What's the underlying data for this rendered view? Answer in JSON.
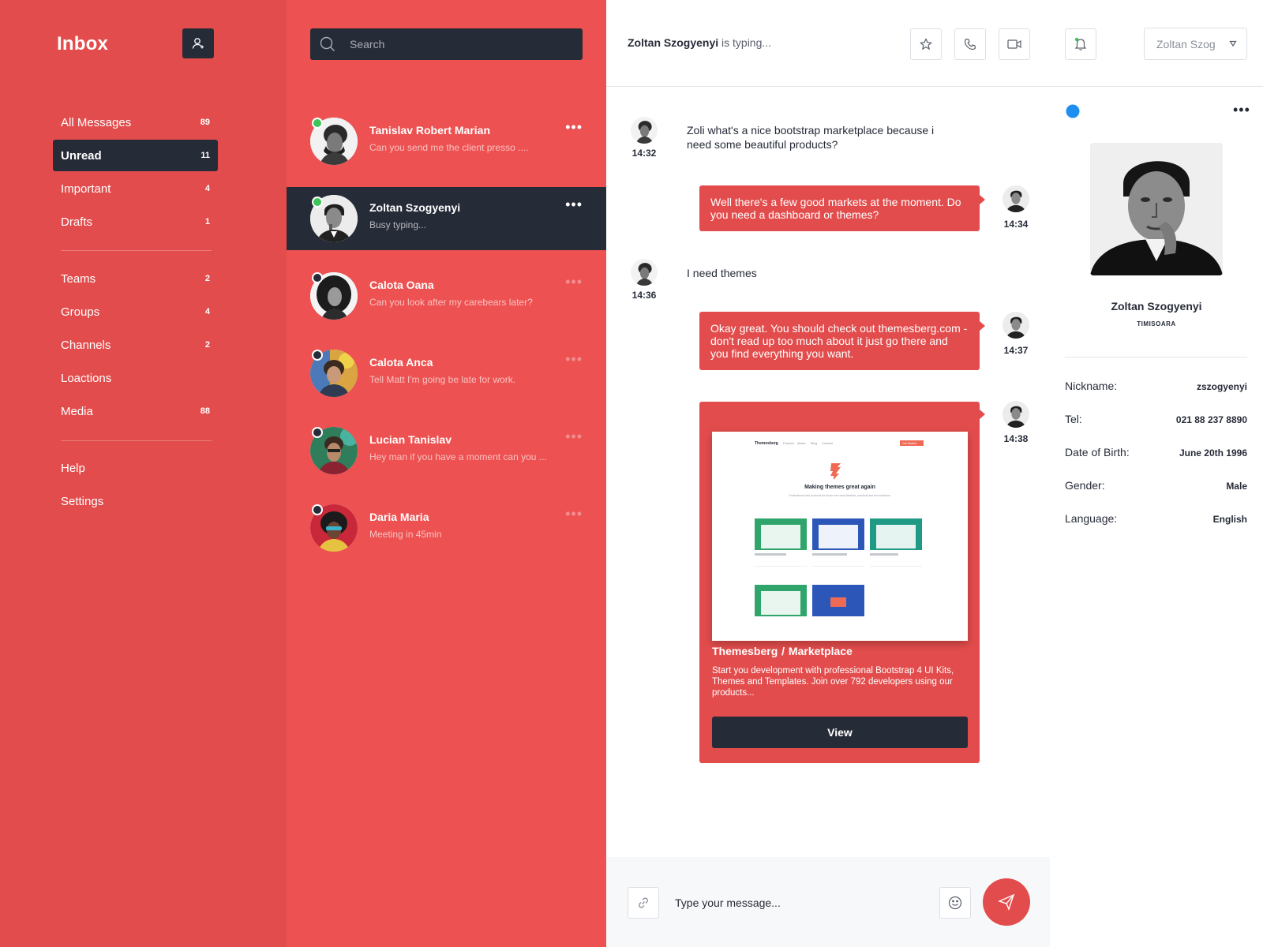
{
  "sidebar": {
    "title": "Inbox",
    "new_contact_icon": "user-plus-icon",
    "primary_items": [
      {
        "label": "All Messages",
        "count": "89"
      },
      {
        "label": "Unread",
        "count": "11"
      },
      {
        "label": "Important",
        "count": "4"
      },
      {
        "label": "Drafts",
        "count": "1"
      }
    ],
    "secondary_items": [
      {
        "label": "Teams",
        "count": "2"
      },
      {
        "label": "Groups",
        "count": "4"
      },
      {
        "label": "Channels",
        "count": "2"
      },
      {
        "label": "Loactions",
        "count": ""
      },
      {
        "label": "Media",
        "count": "88"
      }
    ],
    "tertiary_items": [
      {
        "label": "Help"
      },
      {
        "label": "Settings"
      }
    ],
    "active_item": "Unread"
  },
  "search": {
    "placeholder": "Search"
  },
  "conversations": [
    {
      "name": "Tanislav Robert Marian",
      "preview": "Can you send me the client presso ....",
      "status": "online"
    },
    {
      "name": "Zoltan Szogyenyi",
      "preview": "Busy typing...",
      "status": "online",
      "selected": true
    },
    {
      "name": "Calota Oana",
      "preview": "Can you look after my carebears later?",
      "status": "offline"
    },
    {
      "name": "Calota Anca",
      "preview": "Tell Matt I'm going be late for work.",
      "status": "offline"
    },
    {
      "name": "Lucian Tanislav",
      "preview": "Hey man if you have a moment can you ...",
      "status": "offline"
    },
    {
      "name": "Daria Maria",
      "preview": "Meeting in 45min",
      "status": "offline"
    }
  ],
  "chat_header": {
    "contact_name": "Zoltan Szogyenyi",
    "typing_suffix": " is typing...",
    "buttons": [
      "star-icon",
      "phone-icon",
      "video-icon",
      "bell-icon"
    ],
    "user_select_value": "Zoltan Szog"
  },
  "messages": [
    {
      "direction": "in",
      "text": "Zoli what's a nice bootstrap marketplace because i need some beautiful products?",
      "time": "14:32"
    },
    {
      "direction": "out",
      "text": "Well there's a few good markets at the moment. Do you need a dashboard or themes?",
      "time": "14:34"
    },
    {
      "direction": "in",
      "text": "I need themes",
      "time": "14:36"
    },
    {
      "direction": "out",
      "text": "Okay great. You should check out themesberg.com - don't read up too much about it just go there and you find everything you want.",
      "time": "14:37"
    },
    {
      "direction": "out",
      "type": "card",
      "time": "14:38",
      "card": {
        "title": "Themesberg  /  Marketplace",
        "description": "Start you development with professional Bootstrap 4 UI Kits, Themes and Templates. Join over 792 developers using our products...",
        "button": "View",
        "preview": {
          "brand": "Themesberg",
          "nav": [
            "Product",
            "About",
            "Blog",
            "Contact"
          ],
          "cta": "Get Started",
          "headline": "Making themes great again",
          "tagline": "Professional web products for those who want flawless, practical and fast solutions."
        }
      }
    }
  ],
  "composer": {
    "placeholder": "Type your message...",
    "attach_icon": "link-icon",
    "emoji_icon": "smile-icon",
    "send_icon": "send-icon"
  },
  "profile": {
    "name": "Zoltan Szogyenyi",
    "city": "TIMISOARA",
    "details": [
      {
        "label": "Nickname:",
        "value": "zszogyenyi"
      },
      {
        "label": "Tel:",
        "value": "021 88 237 8890"
      },
      {
        "label": "Date of Birth:",
        "value": "June 20th 1996"
      },
      {
        "label": "Gender:",
        "value": "Male"
      },
      {
        "label": "Language:",
        "value": "English"
      }
    ]
  },
  "colors": {
    "accent": "#e34c4c",
    "list_bg": "#ed5151",
    "dark": "#262b38",
    "online": "#3cc558"
  }
}
